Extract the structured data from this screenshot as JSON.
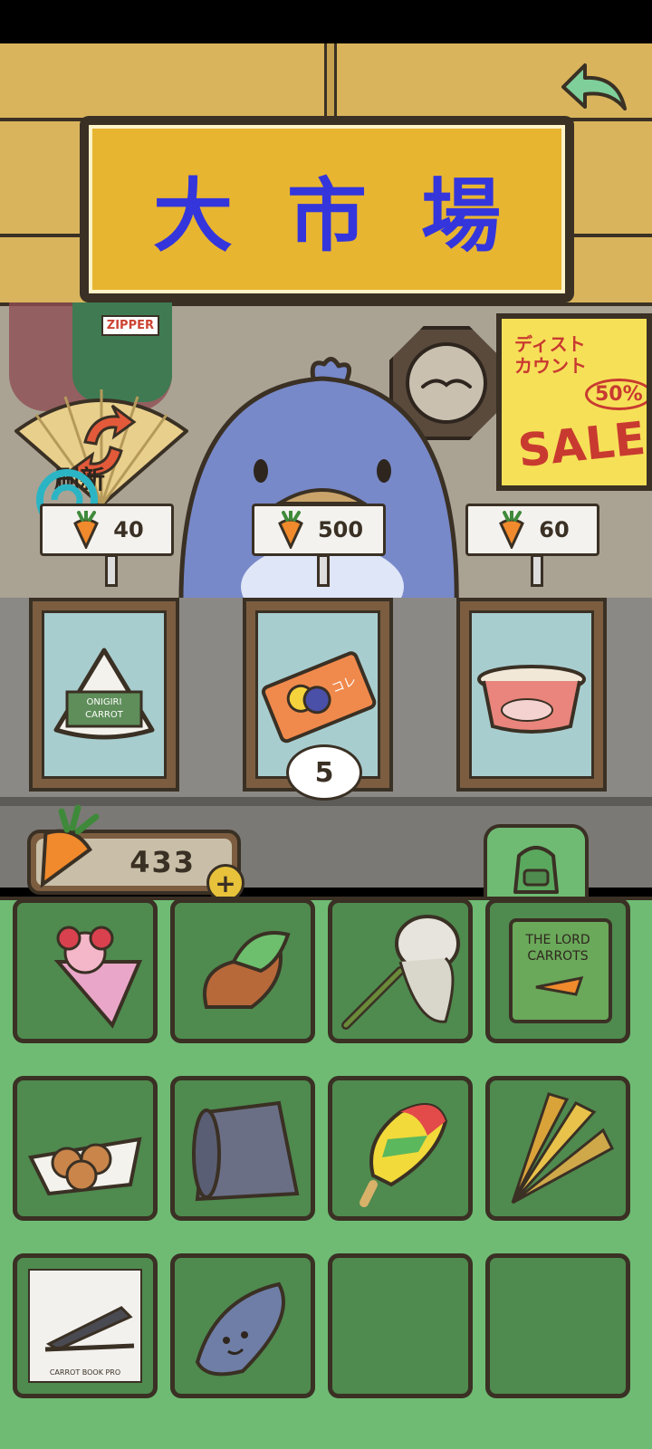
{
  "header": {
    "sign_title": "大市場",
    "back_icon": "back-arrow-icon"
  },
  "shop": {
    "refresh_label": "刷新",
    "poster": {
      "title_line1": "ディスト",
      "title_line2": "カウント",
      "discount": "50%",
      "sale": "SALE"
    },
    "shirt_tag": "ZIPPER"
  },
  "items_for_sale": [
    {
      "name": "onigiri",
      "price": "40",
      "icon": "onigiri-icon"
    },
    {
      "name": "collection-ticket",
      "price": "500",
      "icon": "ticket-icon",
      "quantity": "5"
    },
    {
      "name": "cup-noodle",
      "price": "60",
      "icon": "cup-noodle-icon"
    }
  ],
  "wallet": {
    "carrots": "433",
    "add_label": "+"
  },
  "inventory": {
    "items": [
      {
        "icon": "crepe-icon"
      },
      {
        "icon": "taiyaki-icecream-icon"
      },
      {
        "icon": "bug-net-icon"
      },
      {
        "icon": "book-icon",
        "label": "THE LORD OF THE CARROTS"
      },
      {
        "icon": "takoyaki-icon"
      },
      {
        "icon": "rolled-mat-icon"
      },
      {
        "icon": "popsicle-icon"
      },
      {
        "icon": "folding-fan-icon"
      },
      {
        "icon": "laptop-icon",
        "label": "CARROT BOOK PRO"
      },
      {
        "icon": "surfboard-icon"
      },
      {
        "icon": "empty-slot"
      },
      {
        "icon": "empty-slot"
      }
    ]
  },
  "colors": {
    "sign_bg": "#e8b530",
    "sign_text": "#3436dc",
    "inventory_bg": "#6fbb74",
    "slot_bg": "#4f8a4f",
    "outline": "#3a3024"
  }
}
